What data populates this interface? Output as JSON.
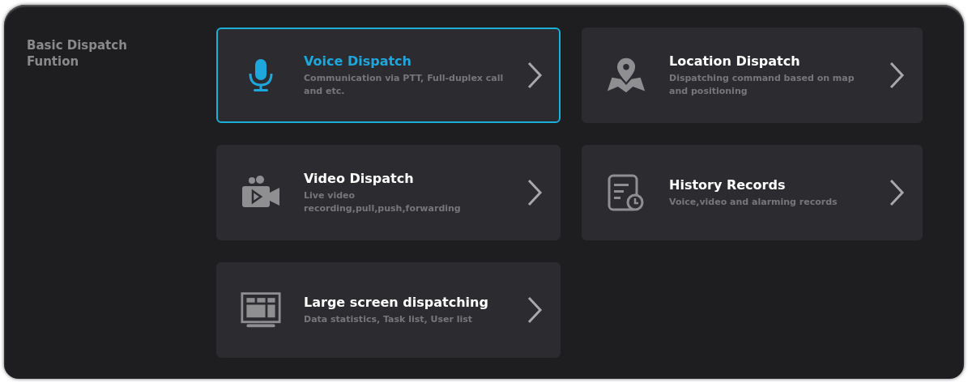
{
  "section": {
    "title": "Basic Dispatch Funtion"
  },
  "cards": [
    {
      "kind": "microphone",
      "title": "Voice Dispatch",
      "description": "Communication via PTT, Full-duplex call and etc.",
      "selected": true
    },
    {
      "kind": "map-pin",
      "title": "Location Dispatch",
      "description": "Dispatching command based on map and positioning",
      "selected": false
    },
    {
      "kind": "video",
      "title": "Video Dispatch",
      "description": "Live video recording,pull,push,forwarding",
      "selected": false
    },
    {
      "kind": "history",
      "title": "History Records",
      "description": "Voice,video and alarming records",
      "selected": false
    },
    {
      "kind": "screen",
      "title": "Large screen dispatching",
      "description": "Data statistics, Task list, User list",
      "selected": false
    }
  ]
}
